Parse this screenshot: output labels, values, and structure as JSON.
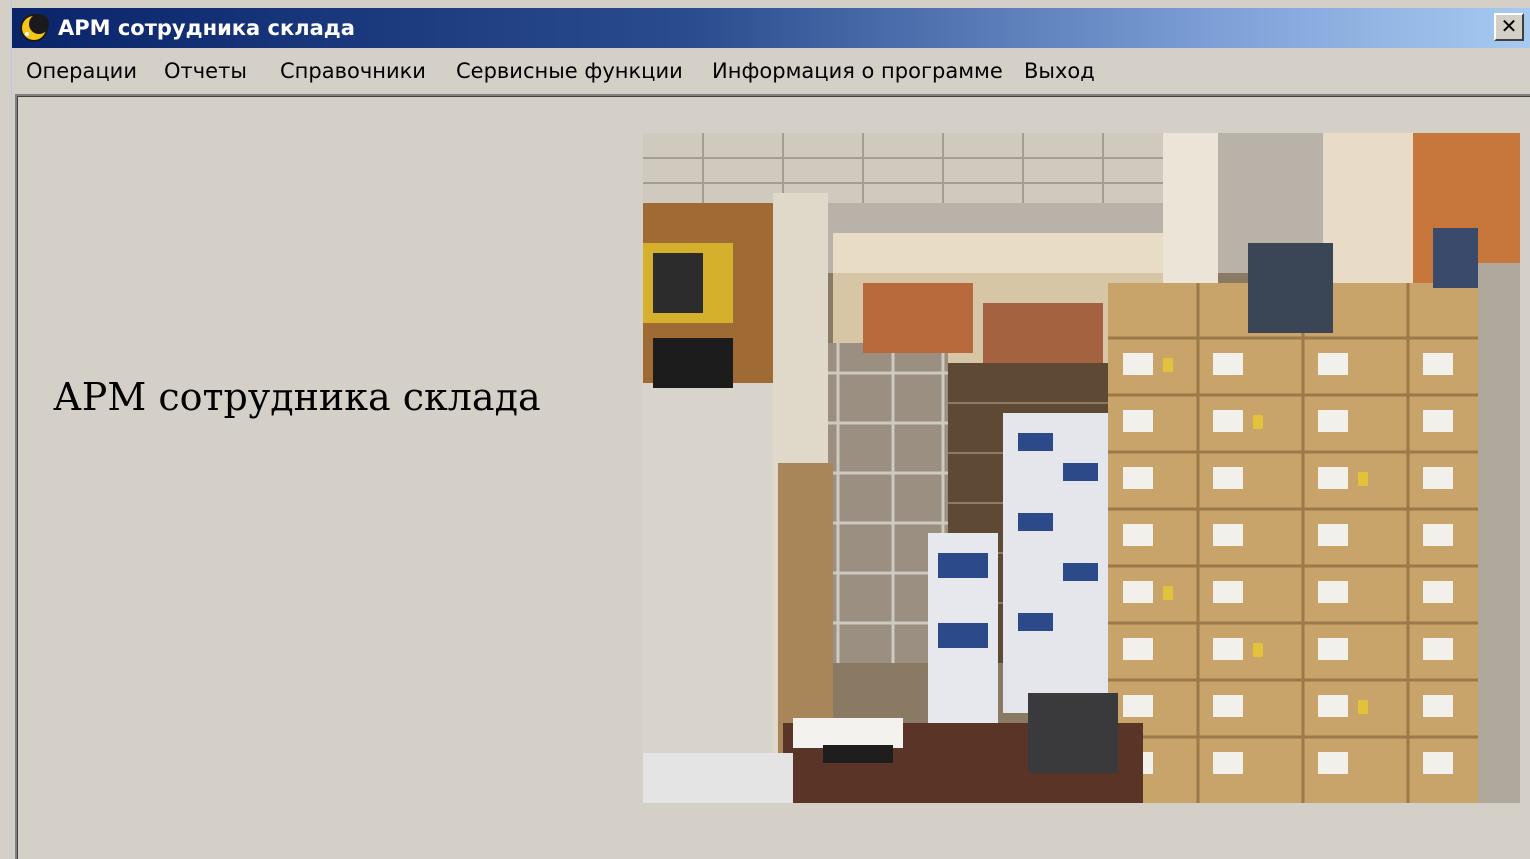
{
  "window": {
    "title": "АРМ сотрудника склада",
    "close_label": "✕"
  },
  "menu": {
    "items": [
      "Операции",
      "Отчеты",
      "Справочники",
      "Сервисные функции",
      "Информация о программе",
      "Выход"
    ]
  },
  "main": {
    "heading": "АРМ сотрудника склада"
  },
  "icons": {
    "app": "moon-app-icon",
    "close": "close-icon"
  },
  "colors": {
    "titlebar_start": "#0a246a",
    "titlebar_end": "#a6caf0",
    "window_bg": "#d4d0c8"
  }
}
